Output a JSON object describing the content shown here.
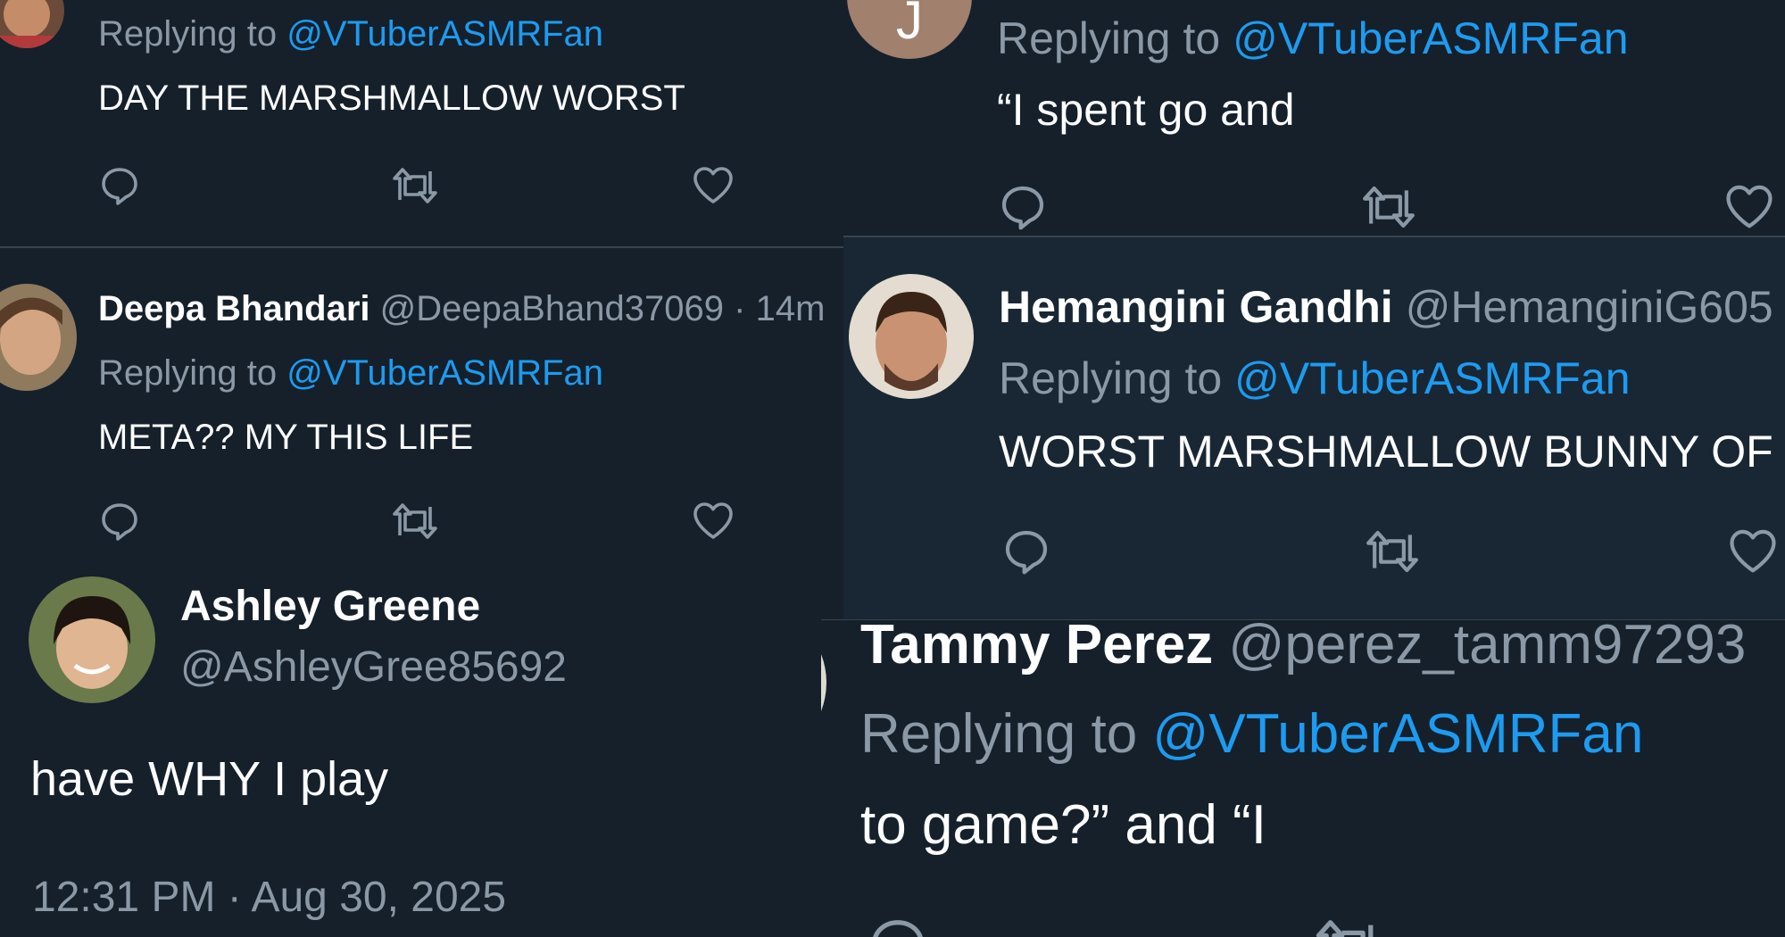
{
  "colors": {
    "background": "#15202b",
    "panel_alt": "#192734",
    "text": "#ffffff",
    "muted": "#8b98a5",
    "link": "#1d9bf0",
    "divider": "#38444d"
  },
  "replies": [
    {
      "replying_prefix": "Replying to",
      "replying_handle": "@VTuberASMRFan",
      "text": "DAY THE MARSHMALLOW WORST"
    },
    {
      "name": "Deepa Bhandari",
      "handle_time": "@DeepaBhand37069 · 14m",
      "replying_prefix": "Replying to",
      "replying_handle": "@VTuberASMRFan",
      "text": "META?? MY THIS LIFE"
    },
    {
      "name": "Ashley Greene",
      "handle": "@AshleyGree85692",
      "text": "have WHY I play",
      "timestamp": "12:31 PM · Aug 30, 2025"
    },
    {
      "avatar_letter": "J",
      "replying_prefix": "Replying to",
      "replying_handle": "@VTuberASMRFan",
      "text": "“I spent go and"
    },
    {
      "name": "Hemangini Gandhi",
      "handle": "@HemanginiG605",
      "replying_prefix": "Replying to",
      "replying_handle": "@VTuberASMRFan",
      "text": "WORST MARSHMALLOW BUNNY OF"
    },
    {
      "name": "Tammy Perez",
      "handle": "@perez_tamm97293",
      "replying_prefix": "Replying to",
      "replying_handle": "@VTuberASMRFan",
      "text": "to game?” and “I"
    }
  ],
  "icons": {
    "reply": "reply-icon",
    "retweet": "retweet-icon",
    "like": "like-icon"
  }
}
